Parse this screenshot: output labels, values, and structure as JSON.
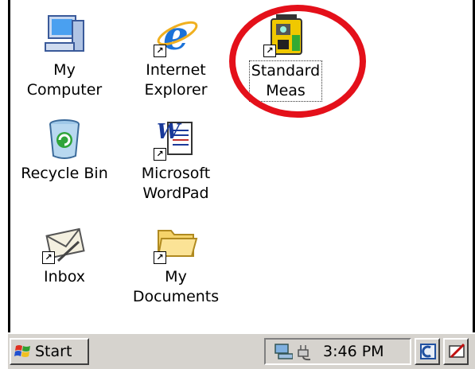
{
  "desktop_icons": [
    {
      "id": "my-computer",
      "label_line1": "My",
      "label_line2": "Computer",
      "icon": "computer-icon"
    },
    {
      "id": "internet-explorer",
      "label_line1": "Internet",
      "label_line2": "Explorer",
      "icon": "internet-explorer-icon"
    },
    {
      "id": "standard-meas",
      "label_line1": "Standard",
      "label_line2": "Meas",
      "icon": "survey-instrument-icon",
      "selected": true
    },
    {
      "id": "recycle-bin",
      "label_line1": "Recycle Bin",
      "label_line2": "",
      "icon": "recycle-bin-icon"
    },
    {
      "id": "microsoft-wordpad",
      "label_line1": "Microsoft",
      "label_line2": "WordPad",
      "icon": "wordpad-icon"
    },
    {
      "id": "inbox",
      "label_line1": "Inbox",
      "label_line2": "",
      "icon": "inbox-icon"
    },
    {
      "id": "my-documents",
      "label_line1": "My",
      "label_line2": "Documents",
      "icon": "folder-icon"
    }
  ],
  "taskbar": {
    "start_label": "Start",
    "clock": "3:46 PM"
  },
  "colors": {
    "highlight_ring": "#e4101a",
    "taskbar_bg": "#d6d3ce"
  }
}
